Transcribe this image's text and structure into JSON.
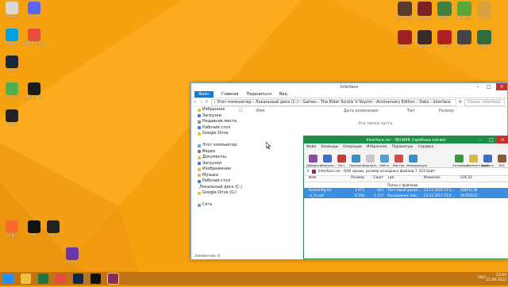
{
  "desktop": {
    "left_icons": [
      {
        "label": "Корзина",
        "color": "#d8d8d8"
      },
      {
        "label": "Discord",
        "color": "#5865f2"
      },
      {
        "label": "Skype",
        "color": "#00a0e6"
      },
      {
        "label": "Google Chrome",
        "color": "#e74c3c"
      },
      {
        "label": "Steam",
        "color": "#1b2838"
      },
      {
        "label": "uTorrent",
        "color": "#4caf50"
      },
      {
        "label": "Nexus Mod",
        "color": "#1a1a1a"
      },
      {
        "label": "Unity",
        "color": "#222"
      },
      {
        "label": "Origin",
        "color": "#f56c2d"
      },
      {
        "label": "EA",
        "color": "#111"
      },
      {
        "label": "Twitch",
        "color": "#222"
      },
      {
        "label": "Vegas",
        "color": "#6a37a8"
      }
    ],
    "right_icons": [
      {
        "label": "Call of Duty",
        "color": "#5a3a2a"
      },
      {
        "label": "Assassin",
        "color": "#7b2222"
      },
      {
        "label": "GTA V",
        "color": "#3f7f3f"
      },
      {
        "label": "Minecraft",
        "color": "#5aa63a"
      },
      {
        "label": "CS:GO",
        "color": "#d8a23d"
      },
      {
        "label": "Witcher",
        "color": "#3b2b2b"
      },
      {
        "label": "Hitman",
        "color": "#b02020"
      },
      {
        "label": "Skyrim",
        "color": "#444"
      },
      {
        "label": "Fallout",
        "color": "#2e6b3e"
      },
      {
        "label": "Dota 2",
        "color": "#a02020"
      }
    ]
  },
  "explorer": {
    "title": "Interface",
    "ribbon_tabs": [
      "Файл",
      "Главная",
      "Поделиться",
      "Вид"
    ],
    "address": "› Этот компьютер › Локальный диск (C:) › Games › The Elder Scrolls V Skyrim - Anniversary Edition › Data › Interface",
    "search_placeholder": "Поиск: Interface",
    "nav": [
      {
        "label": "Избранное",
        "color": "#f2c037"
      },
      {
        "label": "Загрузки",
        "color": "#3d7fd8"
      },
      {
        "label": "Недавние места",
        "color": "#7a8fa8"
      },
      {
        "label": "Рабочий стол",
        "color": "#3d7fd8"
      },
      {
        "label": "Google Drive",
        "color": "#f2c037"
      },
      {
        "label": "",
        "color": "transparent"
      },
      {
        "label": "Этот компьютер",
        "color": "#6aa0d8"
      },
      {
        "label": "Видео",
        "color": "#7a7a7a"
      },
      {
        "label": "Документы",
        "color": "#d8b860"
      },
      {
        "label": "Загрузки",
        "color": "#3d7fd8"
      },
      {
        "label": "Изображения",
        "color": "#d8b860"
      },
      {
        "label": "Музыка",
        "color": "#d8b860"
      },
      {
        "label": "Рабочий стол",
        "color": "#3d7fd8"
      },
      {
        "label": "Локальный диск (C:)",
        "color": "#8a8a8a"
      },
      {
        "label": "Google Drive (G:)",
        "color": "#f2c037"
      },
      {
        "label": "",
        "color": "transparent"
      },
      {
        "label": "Сеть",
        "color": "#6aa0d8"
      }
    ],
    "columns": [
      "Имя",
      "Дата изменения",
      "Тип",
      "Размер"
    ],
    "empty_message": "Эта папка пуста.",
    "status": "Элементов: 0"
  },
  "winrar": {
    "title": "Interface.rar - WinRAR (пробная копия)",
    "menu": [
      "Файл",
      "Команды",
      "Операции",
      "Избранное",
      "Параметры",
      "Справка"
    ],
    "tools": [
      {
        "label": "Добавить",
        "color": "#8b4aa8"
      },
      {
        "label": "Извлечь...",
        "color": "#3a6ec8"
      },
      {
        "label": "Тест",
        "color": "#c83a3a"
      },
      {
        "label": "Просмотр",
        "color": "#3a8fc8"
      },
      {
        "label": "Удалить",
        "color": "#c8c8c8"
      },
      {
        "label": "Найти",
        "color": "#4aa0d8"
      },
      {
        "label": "Мастер",
        "color": "#d84a4a"
      },
      {
        "label": "Информация",
        "color": "#3a8fc8"
      },
      {
        "label": "Антивирус",
        "color": "#3a9a3a"
      },
      {
        "label": "Комментарий",
        "color": "#d8b84a"
      },
      {
        "label": "Защита",
        "color": "#3a6ec8"
      },
      {
        "label": "SFX",
        "color": "#8a5a3a"
      }
    ],
    "path_text": "Interface.rar - RAR архив, размер исходных файлов 7 323 байт",
    "headers": [
      "Имя",
      "Размер",
      "Сжат",
      "Тип",
      "Изменён",
      "CRC32"
    ],
    "rows": [
      {
        "name": "..",
        "size": "",
        "packed": "",
        "type": "Папка с файлами",
        "modified": "",
        "crc": "",
        "selected": false
      },
      {
        "name": "fontconfig.txt",
        "size": "1 075",
        "packed": "603",
        "type": "Текстовый докум...",
        "modified": "23.12.2016 15:1...",
        "crc": "03EF1C38",
        "selected": true
      },
      {
        "name": "ru_fn.swf",
        "size": "6 248",
        "packed": "1 117",
        "type": "Расширение Ado...",
        "modified": "23.12.2017 22:4...",
        "crc": "3A7ED61C",
        "selected": true
      }
    ]
  },
  "taskbar": {
    "items": [
      {
        "name": "start",
        "color": "#1e90ff"
      },
      {
        "name": "explorer",
        "color": "#f2c037"
      },
      {
        "name": "excel",
        "color": "#217346"
      },
      {
        "name": "chrome",
        "color": "#e74c3c"
      },
      {
        "name": "photoshop",
        "color": "#0b2a4a"
      },
      {
        "name": "recorder",
        "color": "#111"
      },
      {
        "name": "winrar",
        "color": "#8b2a5a"
      }
    ],
    "lang": "ENG",
    "time": "22:00",
    "date": "22.06.2022"
  }
}
